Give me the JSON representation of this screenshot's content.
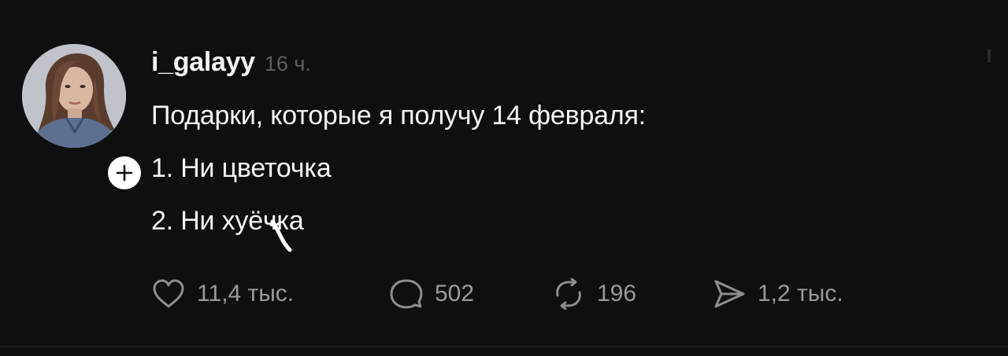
{
  "post": {
    "username": "i_galayy",
    "time": "16 ч.",
    "lines": [
      "Подарки, которые я получу 14 февраля:",
      "1. Ни цветочка",
      "2. Ни хуёчка"
    ],
    "avatar_icon": "profile-photo",
    "follow_icon": "plus-icon",
    "actions": {
      "likes": "11,4 тыс.",
      "comments": "502",
      "reposts": "196",
      "shares": "1,2 тыс."
    },
    "icons": {
      "like": "heart-icon",
      "comment": "speech-bubble-icon",
      "repost": "repost-arrows-icon",
      "share": "paper-plane-icon"
    }
  },
  "colors": {
    "background": "#0f0f0f",
    "text": "#f3f5f7",
    "muted": "#5e5e5e",
    "action_text": "#9a9a9a"
  }
}
